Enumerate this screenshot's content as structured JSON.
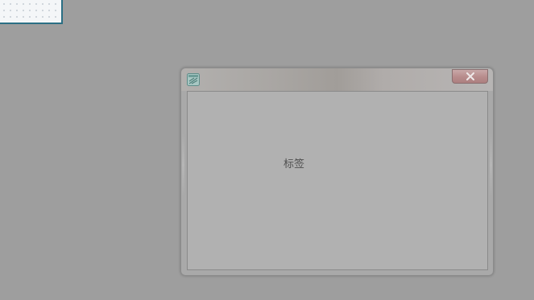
{
  "designer_panel": {
    "grid": "dotted"
  },
  "window": {
    "title": "",
    "app_icon": "form-icon",
    "close_icon": "close-icon",
    "label_text": "标签"
  },
  "colors": {
    "workspace_background": "#9e9e9e",
    "client_area": "#b1b1b1",
    "close_button": "#b98e8e",
    "designer_border": "#2b6f84"
  }
}
